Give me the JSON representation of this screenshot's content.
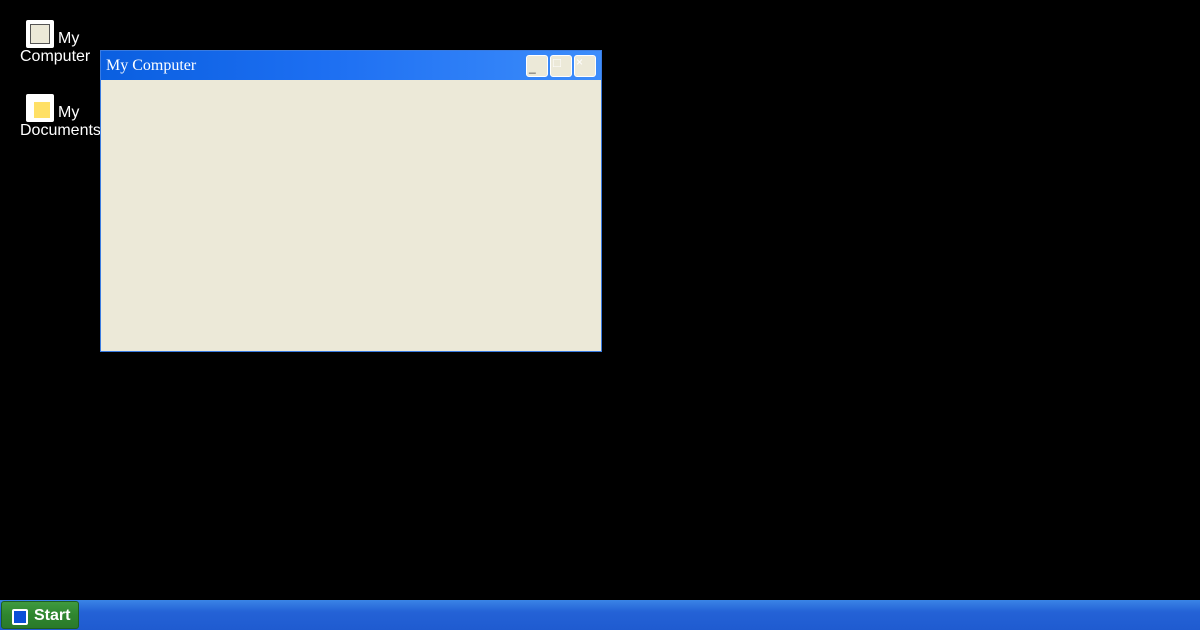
{
  "desktop": {
    "icons": [
      {
        "label_line1": "My",
        "label_line2": "Computer",
        "icon": "computer-icon"
      },
      {
        "label_line1": "My",
        "label_line2": "Documents",
        "icon": "folder-icon"
      }
    ]
  },
  "window": {
    "title": "My Computer",
    "buttons": {
      "minimize": "_",
      "maximize": "□",
      "close": "×"
    }
  },
  "taskbar": {
    "start_label": "Start"
  },
  "colors": {
    "desktop_bg": "#000000",
    "titlebar": "#1d6ff2",
    "window_body": "#ece9d8",
    "taskbar": "#2462d6",
    "start_button": "#2f862f"
  }
}
